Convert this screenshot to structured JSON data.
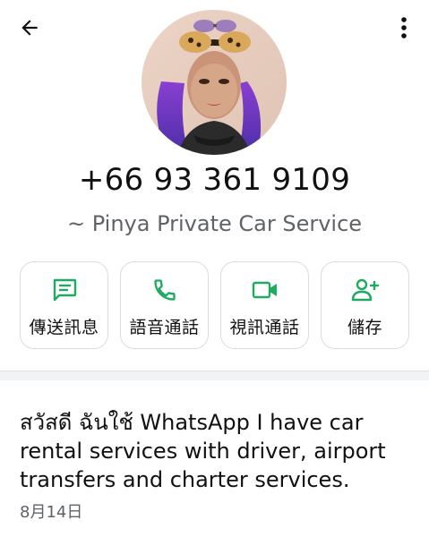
{
  "header": {
    "back_icon": "arrow-back-icon",
    "more_icon": "more-vert-icon"
  },
  "contact": {
    "phone": "+66 93 361 9109",
    "name": "~ Pinya Private Car Service"
  },
  "actions": [
    {
      "label": "傳送訊息",
      "icon": "message-icon"
    },
    {
      "label": "語音通話",
      "icon": "phone-icon"
    },
    {
      "label": "視訊通話",
      "icon": "video-icon"
    },
    {
      "label": "儲存",
      "icon": "add-person-icon"
    }
  ],
  "about": {
    "text": "สวัสดี ฉันใช้ WhatsApp I have car rental services with driver, airport transfers and charter services.",
    "date": "8月14日"
  },
  "colors": {
    "accent": "#1daa61",
    "secondary_text": "#5f6368",
    "border": "#dadce0"
  }
}
